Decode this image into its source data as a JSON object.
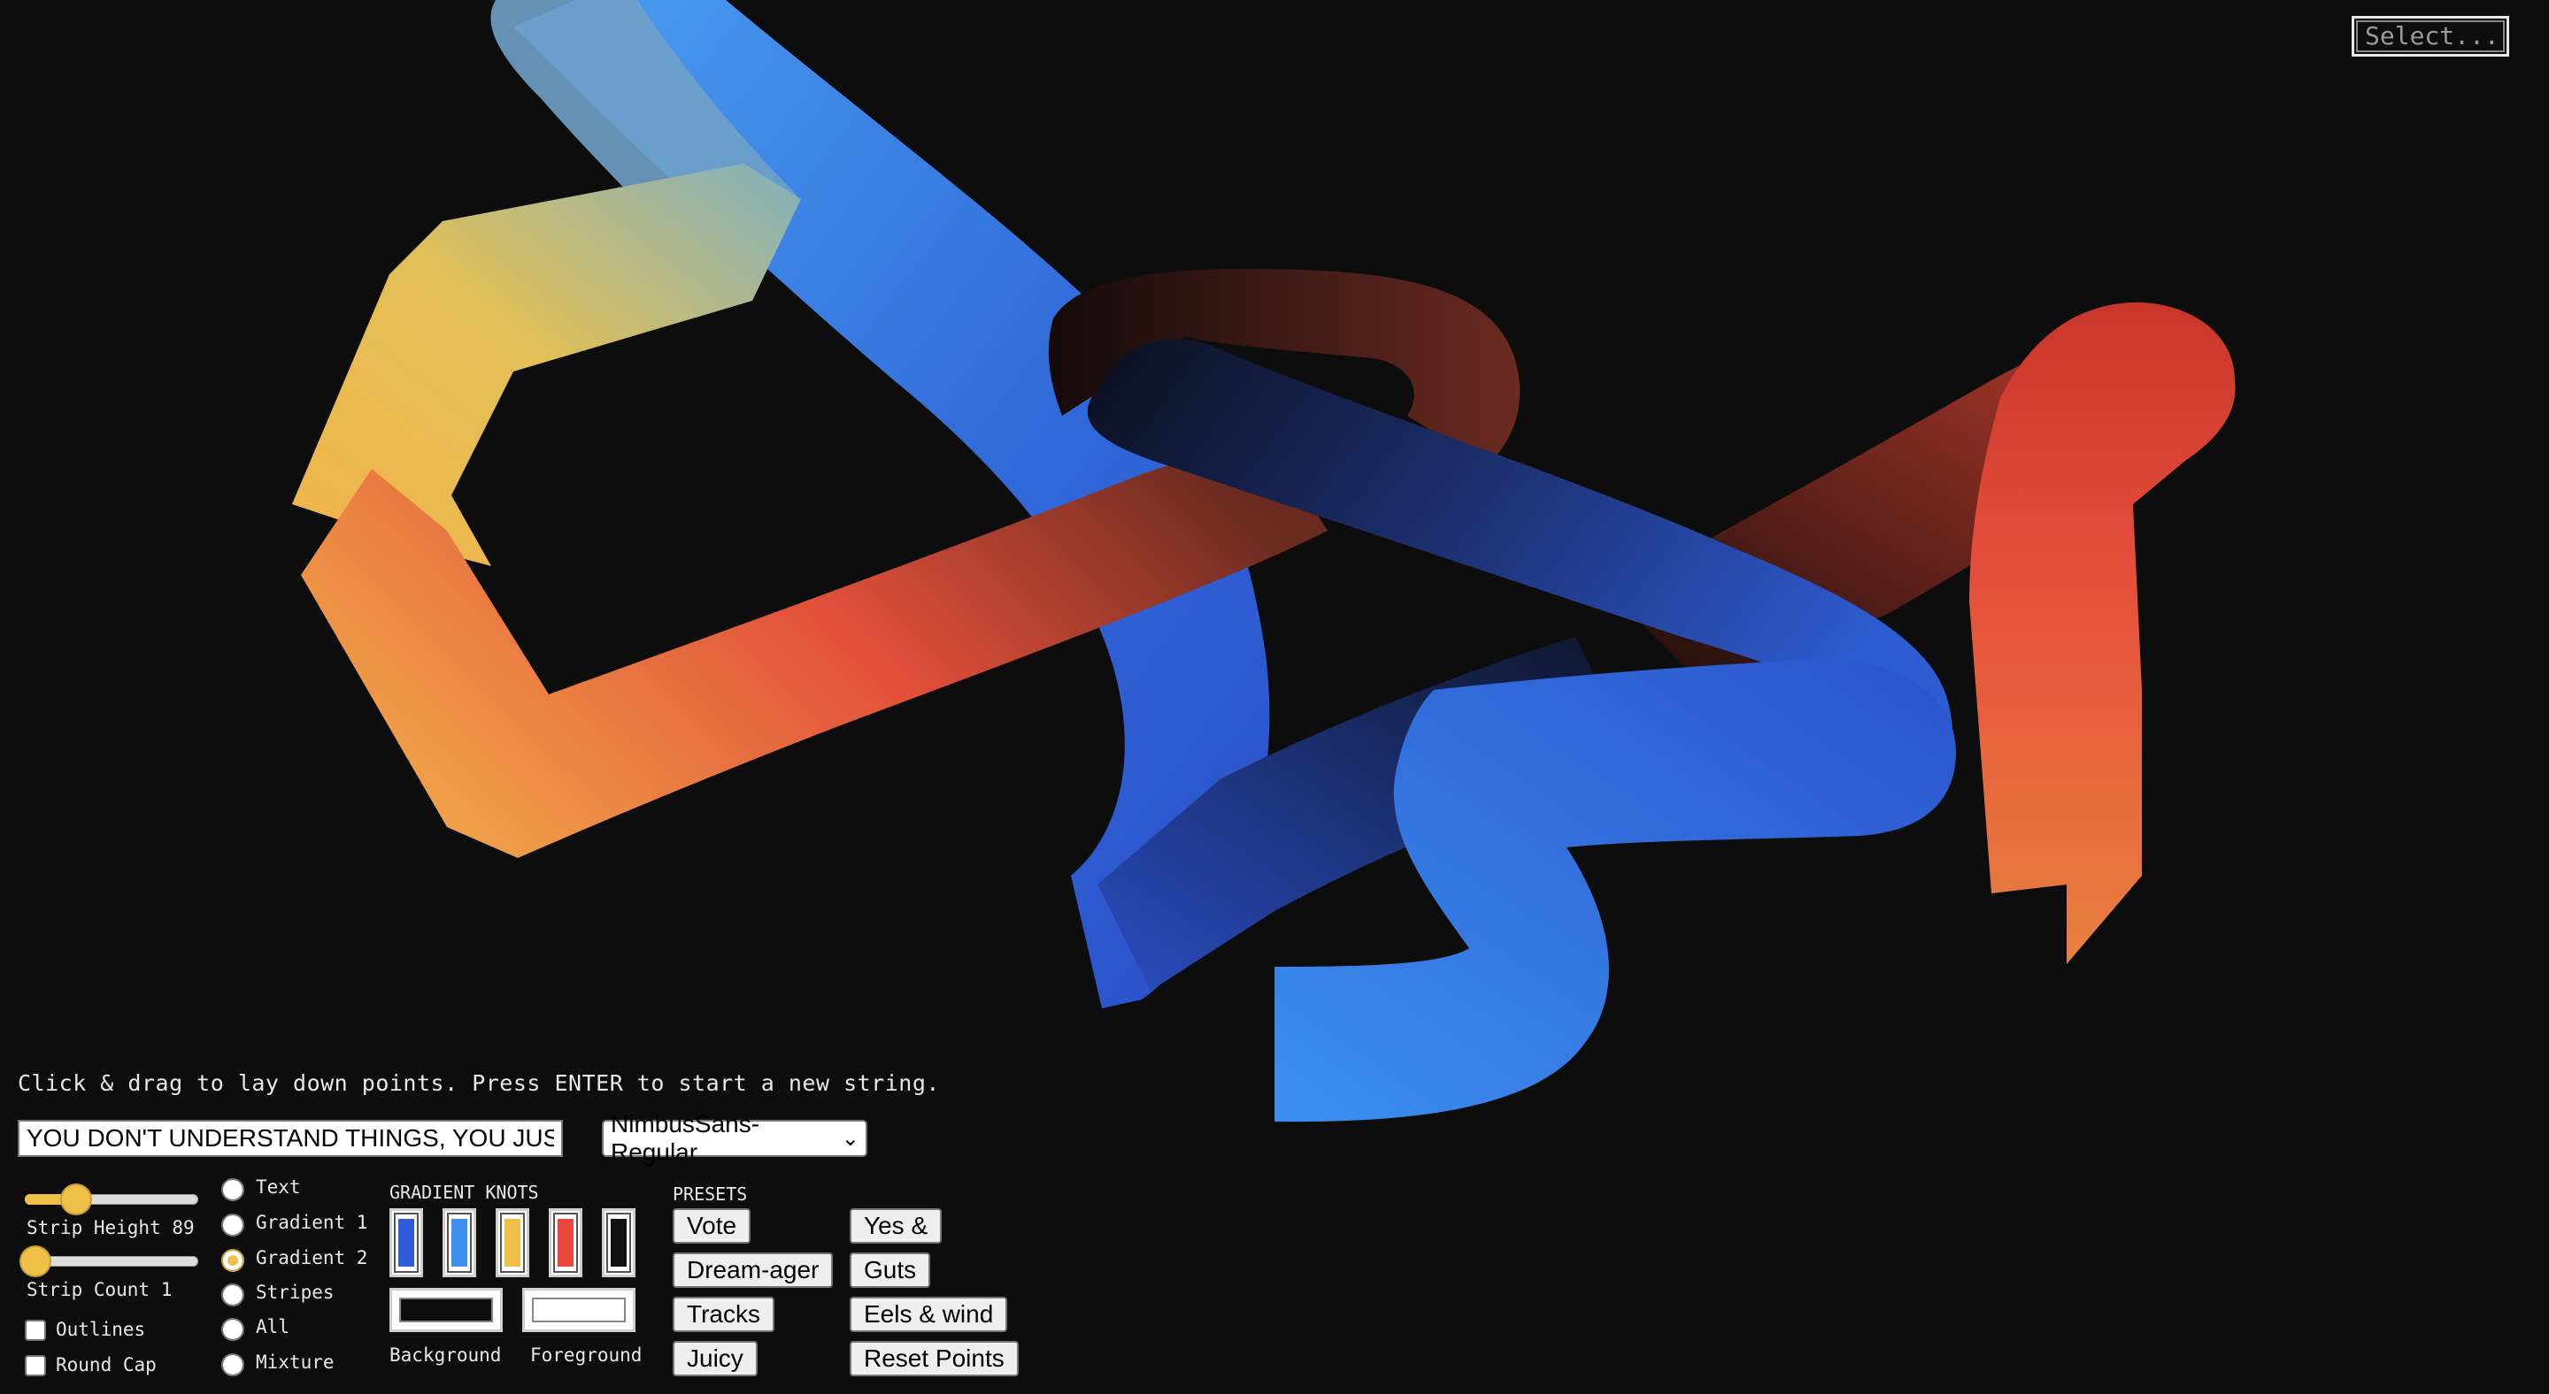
{
  "top_select": {
    "placeholder": "Select..."
  },
  "instructions": "Click & drag to lay down points. Press ENTER to start a new string.",
  "text_input": {
    "value": "YOU DON'T UNDERSTAND THINGS, YOU JUST GET USED TO THEM"
  },
  "font_select": {
    "value": "NimbusSans-Regular"
  },
  "strip_height": {
    "label": "Strip Height 89",
    "value": 89
  },
  "strip_count": {
    "label": "Strip Count 1",
    "value": 1
  },
  "checkboxes": [
    {
      "label": "Outlines",
      "checked": false
    },
    {
      "label": "Round Cap",
      "checked": false
    }
  ],
  "modes": [
    {
      "label": "Text",
      "checked": false
    },
    {
      "label": "Gradient 1",
      "checked": false
    },
    {
      "label": "Gradient 2",
      "checked": true
    },
    {
      "label": "Stripes",
      "checked": false
    },
    {
      "label": "All",
      "checked": false
    },
    {
      "label": "Mixture",
      "checked": false
    }
  ],
  "gradient_knots": {
    "title": "GRADIENT KNOTS",
    "colors": [
      "#2f5bd9",
      "#3d8ff0",
      "#f2be4a",
      "#e8473a",
      "#111111"
    ]
  },
  "background": {
    "label": "Background",
    "color": "#0d0d0d"
  },
  "foreground": {
    "label": "Foreground",
    "color": "#ffffff"
  },
  "presets": {
    "title": "PRESETS",
    "left": [
      "Vote",
      "Dream-ager",
      "Tracks",
      "Juicy"
    ],
    "right": [
      "Yes &",
      "Guts",
      "Eels & wind",
      "Reset Points"
    ]
  },
  "colors": {
    "page_bg": "#0d0d0d",
    "blue": "#3d8ff0",
    "deep_blue": "#2b4fc9",
    "yellow": "#f2be4a",
    "red": "#e8473a",
    "dark": "#111111",
    "slider_accent": "#f0c048"
  }
}
